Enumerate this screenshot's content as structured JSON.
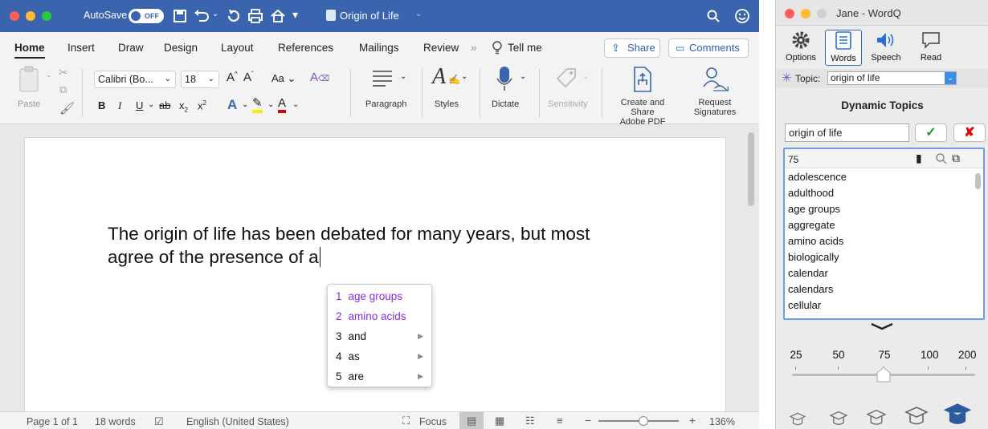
{
  "word": {
    "titlebar": {
      "autosave_label": "AutoSave",
      "autosave_state": "OFF",
      "doc_title": "Origin of Life"
    },
    "tabs": [
      "Home",
      "Insert",
      "Draw",
      "Design",
      "Layout",
      "References",
      "Mailings",
      "Review"
    ],
    "tell_me": "Tell me",
    "share_label": "Share",
    "comments_label": "Comments",
    "ribbon": {
      "paste": "Paste",
      "font_name": "Calibri (Bo...",
      "font_size": "18",
      "paragraph": "Paragraph",
      "styles": "Styles",
      "dictate": "Dictate",
      "sensitivity": "Sensitivity",
      "create_share_pdf_1": "Create and Share",
      "create_share_pdf_2": "Adobe PDF",
      "request_sig_1": "Request",
      "request_sig_2": "Signatures"
    },
    "document": {
      "line1": "The origin of life has been debated for many years, but most",
      "line2": "agree of the presence of a"
    },
    "predictions": [
      {
        "num": "1",
        "word": "age groups",
        "arrow": false,
        "color": "#8a2be2"
      },
      {
        "num": "2",
        "word": "amino acids",
        "arrow": false,
        "color": "#8a2be2"
      },
      {
        "num": "3",
        "word": "and",
        "arrow": true,
        "color": "#111111"
      },
      {
        "num": "4",
        "word": "as",
        "arrow": true,
        "color": "#111111"
      },
      {
        "num": "5",
        "word": "are",
        "arrow": true,
        "color": "#111111"
      }
    ],
    "status": {
      "page": "Page 1 of 1",
      "words": "18 words",
      "language": "English (United States)",
      "focus": "Focus",
      "zoom": "136%"
    }
  },
  "wordq": {
    "title": "Jane - WordQ",
    "toolbar": [
      "Options",
      "Words",
      "Speech",
      "Read"
    ],
    "topic_label": "Topic:",
    "topic_value": "origin of life",
    "dynamic_topics_title": "Dynamic Topics",
    "topic_input": "origin of life",
    "list_count": "75",
    "words_list": [
      "adolescence",
      "adulthood",
      "age groups",
      "aggregate",
      "amino acids",
      "biologically",
      "calendar",
      "calendars",
      "cellular"
    ],
    "slider_ticks": [
      "25",
      "50",
      "75",
      "100",
      "200"
    ],
    "slider_value": 75
  }
}
